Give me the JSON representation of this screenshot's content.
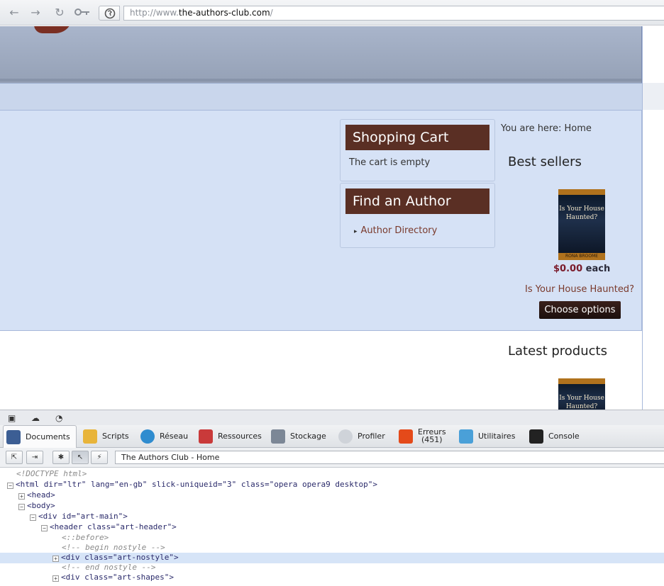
{
  "browser": {
    "url_prefix": "http://www.",
    "url_domain": "the-authors-club.com",
    "url_suffix": "/"
  },
  "page": {
    "shopping_cart": {
      "title": "Shopping Cart",
      "body": "The cart is empty"
    },
    "find_author": {
      "title": "Find an Author",
      "link": "Author Directory"
    },
    "breadcrumb": "You are here: Home",
    "best_sellers": "Best sellers",
    "book": {
      "cover_title": "Is Your House Haunted?",
      "cover_author": "RONA BROOME"
    },
    "price_amount": "$0.00",
    "price_unit": "each",
    "product_link": "Is Your House Haunted?",
    "choose_button": "Choose options",
    "latest_products": "Latest products"
  },
  "devtools": {
    "tabs": [
      {
        "label": "Documents",
        "icon": "documents-icon"
      },
      {
        "label": "Scripts",
        "icon": "scripts-icon"
      },
      {
        "label": "Réseau",
        "icon": "network-icon"
      },
      {
        "label": "Ressources",
        "icon": "resources-icon"
      },
      {
        "label": "Stockage",
        "icon": "storage-icon"
      },
      {
        "label": "Profiler",
        "icon": "profiler-icon"
      },
      {
        "label": "Erreurs",
        "count": "(451)",
        "icon": "errors-icon"
      },
      {
        "label": "Utilitaires",
        "icon": "utilities-icon"
      },
      {
        "label": "Console",
        "icon": "console-icon"
      }
    ],
    "document_select": "The Authors Club - Home",
    "tree": [
      "<!DOCTYPE html>",
      "<html dir=\"ltr\" lang=\"en-gb\" slick-uniqueid=\"3\" class=\"opera opera9 desktop\">",
      "<head>",
      "<body>",
      "<div id=\"art-main\">",
      "<header class=\"art-header\">",
      "<::before>",
      "<!-- begin nostyle -->",
      "<div class=\"art-nostyle\">",
      "<!-- end nostyle -->",
      "<div class=\"art-shapes\">"
    ]
  }
}
